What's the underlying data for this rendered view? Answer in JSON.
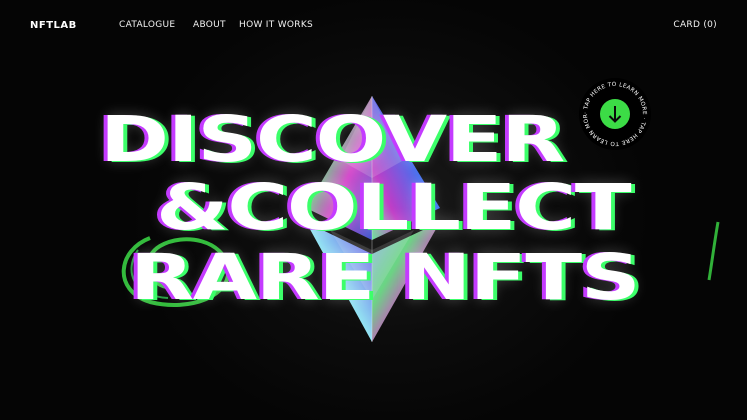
{
  "nav": {
    "logo": "NFTLAB",
    "links": [
      "CATALOGUE",
      "ABOUT",
      "HOW IT WORKS"
    ],
    "cart": "CARD (0)"
  },
  "hero": {
    "lines": [
      "DISCOVER",
      "&COLLECT",
      "RARE NFTS"
    ]
  },
  "badge": {
    "ring_text": "· TAP HERE TO LEARN MORE · TAP HERE TO LEARN MORE",
    "icon": "arrow-down-icon",
    "color": "#3cdc46"
  },
  "colors": {
    "background": "#050505",
    "accent_green": "#3cff6a",
    "accent_purple": "#c43bff"
  }
}
